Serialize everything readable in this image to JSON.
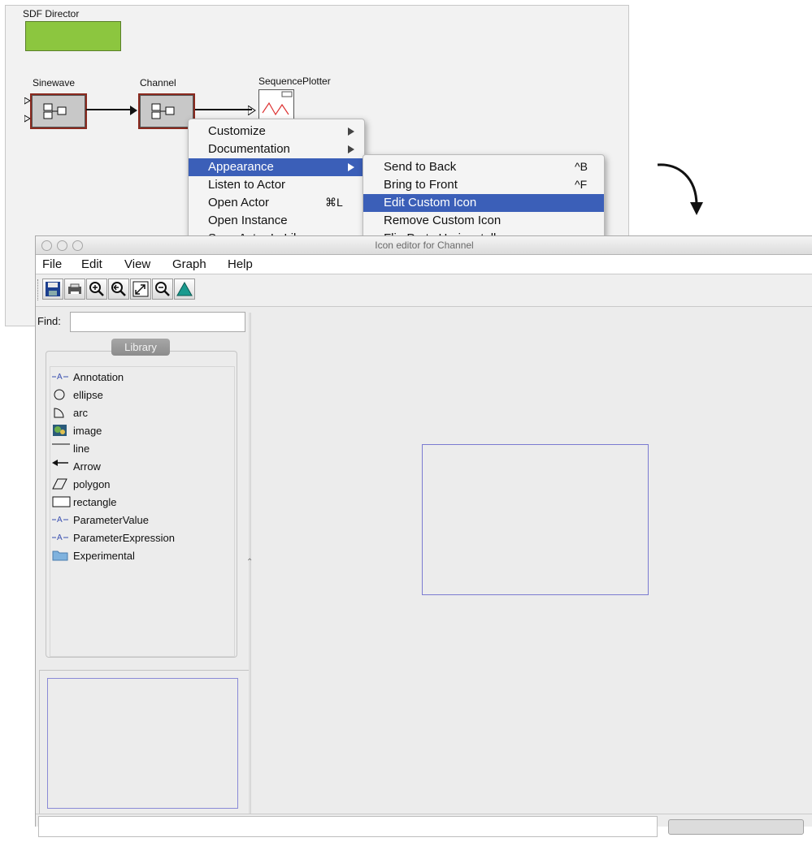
{
  "model": {
    "director_label": "SDF Director",
    "actors": [
      {
        "label": "Sinewave"
      },
      {
        "label": "Channel"
      },
      {
        "label": "SequencePlotter"
      }
    ]
  },
  "context_menu": {
    "items": [
      {
        "label": "Customize",
        "has_submenu": true
      },
      {
        "label": "Documentation",
        "has_submenu": true
      },
      {
        "label": "Appearance",
        "has_submenu": true,
        "selected": true
      },
      {
        "label": "Listen to Actor"
      },
      {
        "label": "Open Actor",
        "shortcut": "⌘L"
      },
      {
        "label": "Open Instance"
      },
      {
        "label": "Save Actor In Library"
      }
    ]
  },
  "appearance_submenu": {
    "items": [
      {
        "label": "Send to Back",
        "shortcut": "^B"
      },
      {
        "label": "Bring to Front",
        "shortcut": "^F"
      },
      {
        "label": "Edit Custom Icon",
        "selected": true
      },
      {
        "label": "Remove Custom Icon"
      },
      {
        "label": "Flip Ports Horizontally"
      }
    ]
  },
  "window": {
    "title": "Icon editor for Channel",
    "menu": [
      "File",
      "Edit",
      "View",
      "Graph",
      "Help"
    ],
    "toolbar_icons": [
      "save-icon",
      "print-icon",
      "zoom-in-icon",
      "zoom-reset-icon",
      "zoom-fit-icon",
      "zoom-out-icon",
      "triangle-icon"
    ],
    "find_label": "Find:",
    "find_value": "",
    "library_title": "Library",
    "library_items": [
      {
        "label": "Annotation",
        "icon": "annotation-icon"
      },
      {
        "label": "ellipse",
        "icon": "ellipse-icon"
      },
      {
        "label": "arc",
        "icon": "arc-icon"
      },
      {
        "label": "image",
        "icon": "image-icon"
      },
      {
        "label": "line",
        "icon": "line-icon"
      },
      {
        "label": "Arrow",
        "icon": "arrow-icon"
      },
      {
        "label": "polygon",
        "icon": "polygon-icon"
      },
      {
        "label": "rectangle",
        "icon": "rectangle-icon"
      },
      {
        "label": "ParameterValue",
        "icon": "annotation-icon"
      },
      {
        "label": "ParameterExpression",
        "icon": "annotation-icon"
      },
      {
        "label": "Experimental",
        "icon": "folder-icon"
      }
    ],
    "status_text": ""
  },
  "colors": {
    "director": "#8cc63f",
    "actor_border": "#8b2a1f",
    "selection": "#3b5fb8",
    "icon_outline": "#7b7bd1"
  }
}
